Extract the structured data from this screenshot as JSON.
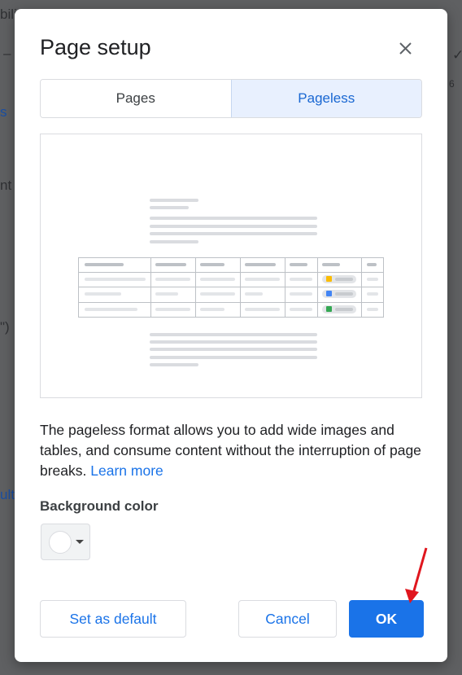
{
  "background": {
    "fragments": [
      "bili",
      "–",
      "s",
      "nt",
      "\")",
      "ult",
      "6",
      "✓"
    ]
  },
  "dialog": {
    "title": "Page setup",
    "close_icon": "close-icon",
    "tabs": [
      {
        "label": "Pages",
        "selected": false
      },
      {
        "label": "Pageless",
        "selected": true
      }
    ],
    "description": "The pageless format allows you to add wide images and tables, and consume content without the interruption of page breaks.",
    "learn_more": "Learn more",
    "background_color_label": "Background color",
    "background_color_value": "#ffffff",
    "buttons": {
      "set_default": "Set as default",
      "cancel": "Cancel",
      "ok": "OK"
    }
  },
  "colors": {
    "accent": "#1a73e8",
    "tab_selected_bg": "#e8f0fe",
    "annotation_arrow": "#e0161e"
  }
}
